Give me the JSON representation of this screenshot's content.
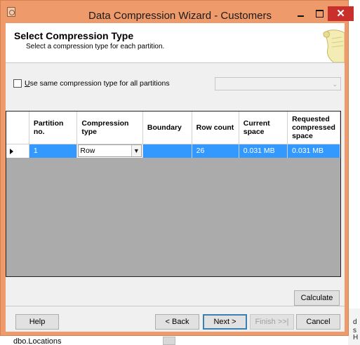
{
  "window": {
    "title": "Data Compression Wizard - Customers",
    "close_glyph": "✕"
  },
  "header": {
    "title": "Select Compression Type",
    "subtitle": "Select a compression type for each partition."
  },
  "options": {
    "same_type_label_underlined": "U",
    "same_type_label_rest": "se same compression type for all partitions",
    "same_type_checked": false
  },
  "grid": {
    "columns": [
      "Partition no.",
      "Compression type",
      "Boundary",
      "Row count",
      "Current space",
      "Requested compressed space"
    ],
    "rows": [
      {
        "partition_no": "1",
        "compression_type": "Row",
        "boundary": "",
        "row_count": "26",
        "current_space": "0.031 MB",
        "requested_space": "0.031 MB"
      }
    ]
  },
  "buttons": {
    "calculate": "Calculate",
    "help": "Help",
    "back": "< Back",
    "next": "Next >",
    "finish": "Finish >>|",
    "cancel": "Cancel"
  },
  "background": {
    "tree_item": "dbo.Locations",
    "side_chars": [
      "d",
      "s",
      "H"
    ]
  },
  "colors": {
    "window_frame": "#ee9a6b",
    "selection": "#3399ff",
    "close_button": "#c9302c"
  }
}
